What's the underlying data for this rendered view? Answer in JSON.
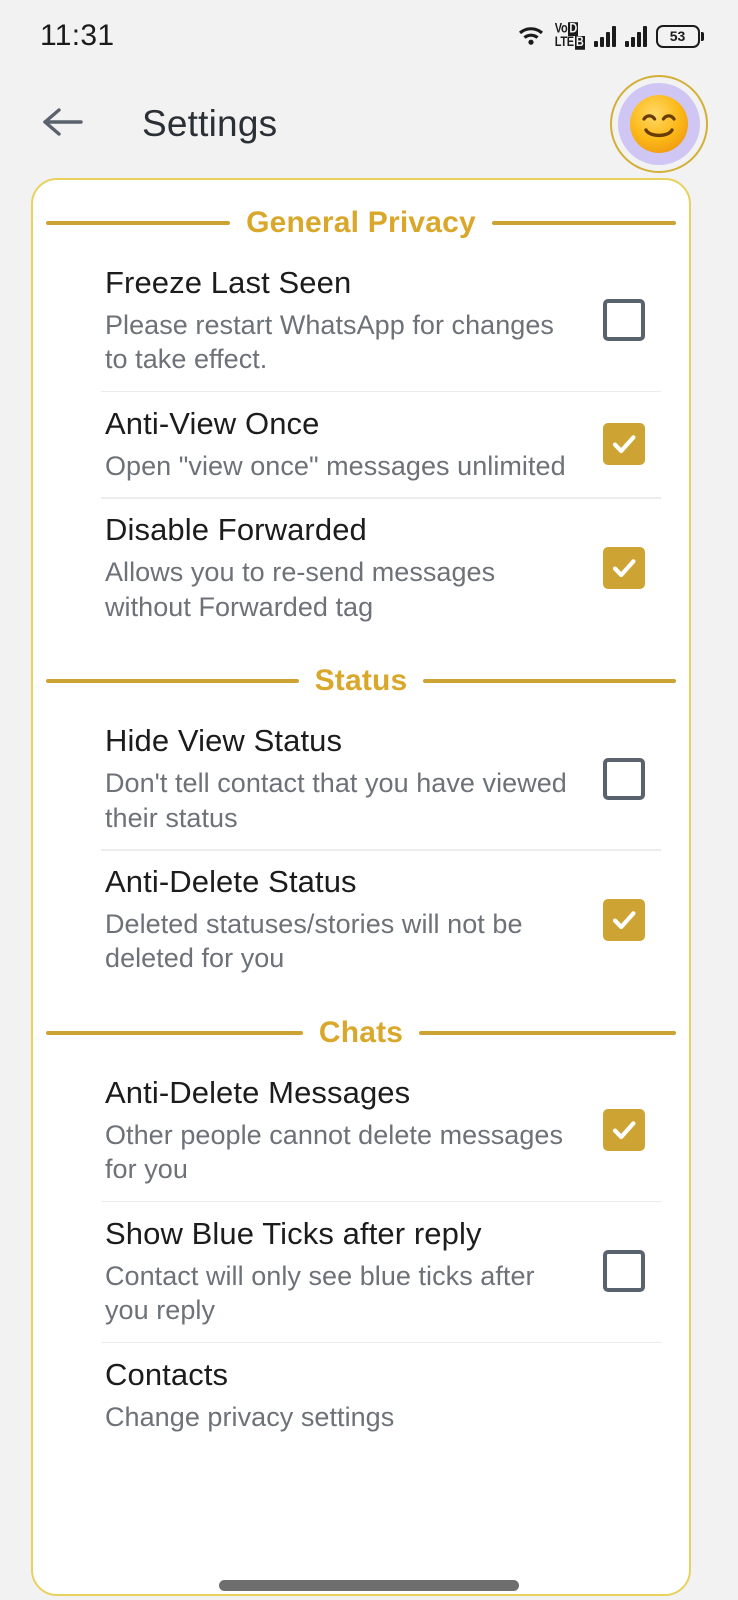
{
  "status_bar": {
    "time": "11:31",
    "wifi_icon": "wifi-icon",
    "volte": {
      "line1_a": "Vo",
      "line1_b": "D",
      "line2_a": "LTE",
      "line2_b": "B"
    },
    "signal_1_icon": "signal-bars-icon",
    "signal_2_icon": "signal-bars-icon",
    "battery_level": "53"
  },
  "app_bar": {
    "back_icon": "back-arrow-icon",
    "title": "Settings",
    "avatar_icon": "smiling-face-emoji"
  },
  "colors": {
    "accent_gold": "#cda434",
    "section_label": "#d9a72a",
    "card_border": "#e8d15c",
    "checkbox_off_border": "#59636e",
    "title_text": "#1c1c1c",
    "sub_text": "#6d7178",
    "page_bg": "#f2f2f2",
    "avatar_bg": "#cfc6f4"
  },
  "sections": [
    {
      "label": "General Privacy",
      "rows": [
        {
          "title": "Freeze Last Seen",
          "subtitle": "Please restart WhatsApp for changes to take effect.",
          "checked": false
        },
        {
          "title": "Anti-View Once",
          "subtitle": "Open \"view once\" messages unlimited",
          "checked": true
        },
        {
          "title": "Disable Forwarded",
          "subtitle": "Allows you to re-send messages without Forwarded tag",
          "checked": true
        }
      ]
    },
    {
      "label": "Status",
      "rows": [
        {
          "title": "Hide View Status",
          "subtitle": "Don't tell contact that you have viewed their status",
          "checked": false
        },
        {
          "title": "Anti-Delete Status",
          "subtitle": "Deleted statuses/stories will not be deleted for you",
          "checked": true
        }
      ]
    },
    {
      "label": "Chats",
      "rows": [
        {
          "title": "Anti-Delete Messages",
          "subtitle": "Other people cannot delete messages for you",
          "checked": true
        },
        {
          "title": "Show Blue Ticks after reply",
          "subtitle": "Contact will only see blue ticks after you reply",
          "checked": false
        },
        {
          "title": "Contacts",
          "subtitle": "Change privacy settings",
          "checked": null
        }
      ]
    }
  ]
}
